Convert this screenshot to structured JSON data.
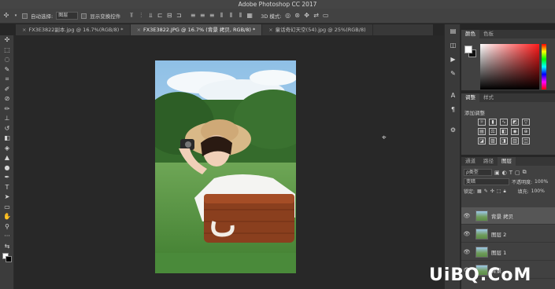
{
  "app": {
    "title": "Adobe Photoshop CC 2017"
  },
  "options_bar": {
    "auto_select_label": "自动选择:",
    "auto_select_value": "图层",
    "show_transform_label": "显示变换控件",
    "mode_3d_label": "3D 模式:"
  },
  "tabs": [
    {
      "label": "FX3E3822副本.jpg @ 16.7%(RGB/8) *"
    },
    {
      "label": "FX3E3822.JPG @ 16.7% (背景 拷贝, RGB/8) *"
    },
    {
      "label": "童话奇幻天空(54).jpg @ 25%(RGB/8)"
    }
  ],
  "tools": [
    "move-tool",
    "marquee-tool",
    "lasso-tool",
    "quick-select-tool",
    "crop-tool",
    "eyedropper-tool",
    "healing-tool",
    "brush-tool",
    "stamp-tool",
    "history-brush-tool",
    "eraser-tool",
    "gradient-tool",
    "blur-tool",
    "dodge-tool",
    "pen-tool",
    "type-tool",
    "path-select-tool",
    "shape-tool",
    "hand-tool",
    "zoom-tool"
  ],
  "color_panel": {
    "tab1": "颜色",
    "tab2": "色板"
  },
  "adjust_panel": {
    "tab1": "调整",
    "tab2": "样式",
    "add_label": "添加调整"
  },
  "layers_panel": {
    "tabs": [
      "通道",
      "路径",
      "图层"
    ],
    "kind_label": "ρ类型",
    "blend_mode": "变暗",
    "opacity_label": "不透明度:",
    "opacity_value": "100%",
    "lock_label": "锁定:",
    "fill_label": "填充:",
    "fill_value": "100%",
    "layers": [
      {
        "name": "背景 拷贝",
        "selected": true
      },
      {
        "name": "图层 2",
        "selected": false
      },
      {
        "name": "图层 1",
        "selected": false
      },
      {
        "name": "背景",
        "selected": false
      }
    ]
  },
  "watermark": "UiBQ.CoM",
  "colors": {
    "accent_red": "#ff1a1a",
    "panel_bg": "#414141",
    "canvas_bg": "#282828"
  }
}
